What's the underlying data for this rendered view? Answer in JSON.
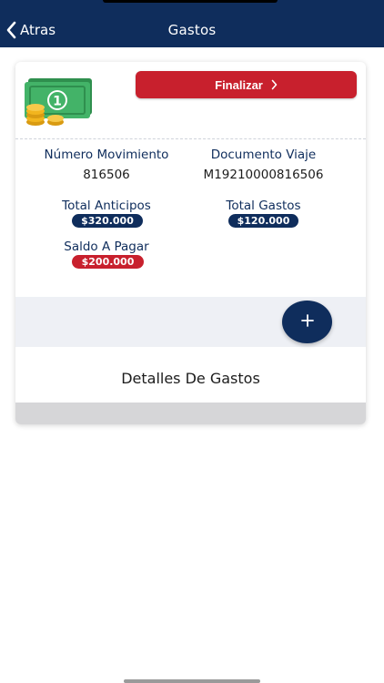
{
  "header": {
    "back_label": "Atras",
    "title": "Gastos"
  },
  "card": {
    "finalizar_label": "Finalizar",
    "numero_movimiento": {
      "label": "Número Movimiento",
      "value": "816506"
    },
    "documento_viaje": {
      "label": "Documento Viaje",
      "value": "M19210000816506"
    },
    "total_anticipos": {
      "label": "Total Anticipos",
      "value": "$320.000"
    },
    "total_gastos": {
      "label": "Total Gastos",
      "value": "$120.000"
    },
    "saldo_a_pagar": {
      "label": "Saldo A Pagar",
      "value": "$200.000"
    },
    "details_title": "Detalles De Gastos"
  },
  "icons": {
    "back": "chevron-left-icon",
    "finalizar": "chevron-right-icon",
    "money": "money-bill-coins-icon",
    "add": "plus-icon"
  },
  "colors": {
    "navy": "#0f2d5c",
    "red": "#c8202d",
    "band": "#eef0f5",
    "money_green": "#3fae62",
    "coin_gold": "#f2b51e"
  }
}
